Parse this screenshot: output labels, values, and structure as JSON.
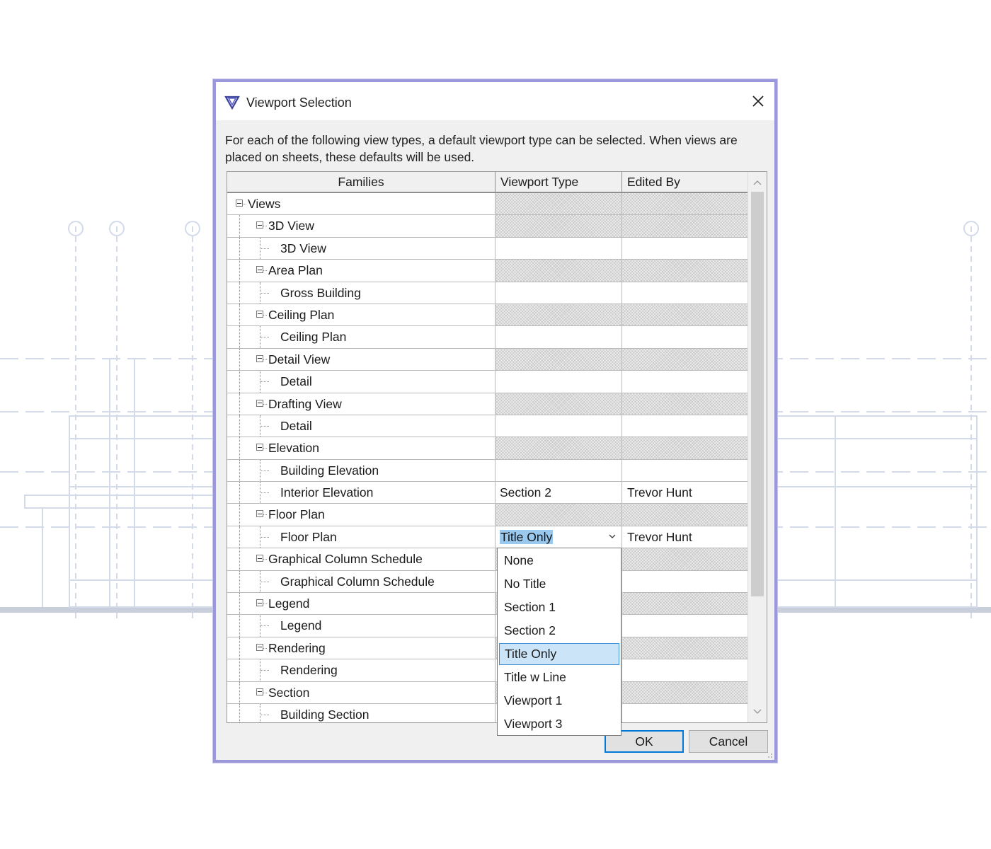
{
  "window": {
    "title": "Viewport Selection",
    "icon": "revit-app-icon",
    "close_icon": "close-icon"
  },
  "description": {
    "line1": "For each of the following view types, a default viewport type can be selected. When views are",
    "line2": "placed on sheets, these defaults will be used."
  },
  "table": {
    "columns": [
      "Families",
      "Viewport Type",
      "Edited By"
    ],
    "rows": [
      {
        "label": "Views",
        "level": 0,
        "group": true,
        "viewport_type": "",
        "edited_by": ""
      },
      {
        "label": "3D View",
        "level": 1,
        "group": true,
        "viewport_type": "",
        "edited_by": ""
      },
      {
        "label": "3D View",
        "level": 2,
        "group": false,
        "viewport_type": "",
        "edited_by": ""
      },
      {
        "label": "Area Plan",
        "level": 1,
        "group": true,
        "viewport_type": "",
        "edited_by": ""
      },
      {
        "label": "Gross Building",
        "level": 2,
        "group": false,
        "viewport_type": "",
        "edited_by": ""
      },
      {
        "label": "Ceiling Plan",
        "level": 1,
        "group": true,
        "viewport_type": "",
        "edited_by": ""
      },
      {
        "label": "Ceiling Plan",
        "level": 2,
        "group": false,
        "viewport_type": "",
        "edited_by": ""
      },
      {
        "label": "Detail View",
        "level": 1,
        "group": true,
        "viewport_type": "",
        "edited_by": ""
      },
      {
        "label": "Detail",
        "level": 2,
        "group": false,
        "viewport_type": "",
        "edited_by": ""
      },
      {
        "label": "Drafting View",
        "level": 1,
        "group": true,
        "viewport_type": "",
        "edited_by": ""
      },
      {
        "label": "Detail",
        "level": 2,
        "group": false,
        "viewport_type": "",
        "edited_by": ""
      },
      {
        "label": "Elevation",
        "level": 1,
        "group": true,
        "viewport_type": "",
        "edited_by": ""
      },
      {
        "label": "Building Elevation",
        "level": 2,
        "group": false,
        "viewport_type": "",
        "edited_by": ""
      },
      {
        "label": "Interior Elevation",
        "level": 2,
        "group": false,
        "viewport_type": "Section 2",
        "edited_by": "Trevor Hunt"
      },
      {
        "label": "Floor Plan",
        "level": 1,
        "group": true,
        "viewport_type": "",
        "edited_by": ""
      },
      {
        "label": "Floor Plan",
        "level": 2,
        "group": false,
        "viewport_type": "Title Only",
        "edited_by": "Trevor Hunt",
        "editing": true
      },
      {
        "label": "Graphical Column Schedule",
        "level": 1,
        "group": true,
        "viewport_type": "",
        "edited_by": ""
      },
      {
        "label": "Graphical Column Schedule",
        "level": 2,
        "group": false,
        "viewport_type": "",
        "edited_by": ""
      },
      {
        "label": "Legend",
        "level": 1,
        "group": true,
        "viewport_type": "",
        "edited_by": ""
      },
      {
        "label": "Legend",
        "level": 2,
        "group": false,
        "viewport_type": "",
        "edited_by": ""
      },
      {
        "label": "Rendering",
        "level": 1,
        "group": true,
        "viewport_type": "",
        "edited_by": ""
      },
      {
        "label": "Rendering",
        "level": 2,
        "group": false,
        "viewport_type": "",
        "edited_by": ""
      },
      {
        "label": "Section",
        "level": 1,
        "group": true,
        "viewport_type": "",
        "edited_by": ""
      },
      {
        "label": "Building Section",
        "level": 2,
        "group": false,
        "viewport_type": "",
        "edited_by": ""
      }
    ]
  },
  "dropdown": {
    "selected": "Title Only",
    "options": [
      "None",
      "No Title",
      "Section 1",
      "Section 2",
      "Title Only",
      "Title w Line",
      "Viewport 1",
      "Viewport 3"
    ]
  },
  "buttons": {
    "ok": "OK",
    "cancel": "Cancel"
  },
  "colors": {
    "dialog_border": "#9b97db",
    "selection": "#99c9ef",
    "ok_border": "#0078d7"
  }
}
